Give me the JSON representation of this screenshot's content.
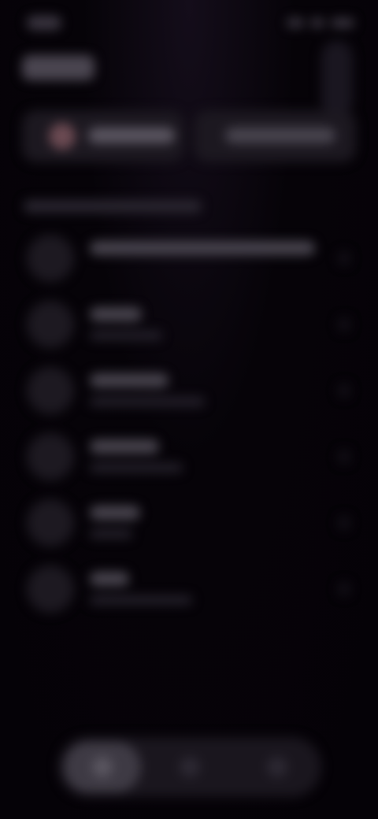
{
  "status_bar": {
    "time": "",
    "indicators": [
      "signal-icon",
      "wifi-icon",
      "battery-icon"
    ]
  },
  "header": {
    "title": "",
    "more_icon": "more-vertical-icon"
  },
  "segments": [
    {
      "label": "",
      "icon": "avatar-icon"
    },
    {
      "label": ""
    }
  ],
  "section": {
    "header": ""
  },
  "list": {
    "items": [
      {
        "primary": "",
        "secondary": ""
      },
      {
        "primary": "",
        "secondary": ""
      },
      {
        "primary": "",
        "secondary": ""
      },
      {
        "primary": "",
        "secondary": ""
      },
      {
        "primary": "",
        "secondary": ""
      },
      {
        "primary": "",
        "secondary": ""
      }
    ]
  },
  "bottom_nav": {
    "items": [
      {
        "icon": "home-icon",
        "active": true
      },
      {
        "icon": "search-icon",
        "active": false
      },
      {
        "icon": "profile-icon",
        "active": false
      }
    ]
  },
  "colors": {
    "background": "#060308",
    "surface": "#1c1820",
    "accent": "#6b4a52"
  }
}
